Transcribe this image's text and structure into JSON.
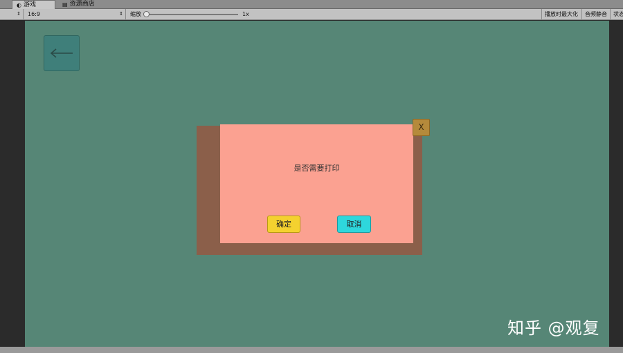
{
  "tabs": {
    "game_label": "游戏",
    "store_label": "资源商店"
  },
  "toolbar": {
    "left_dropdown_value": "",
    "aspect_value": "16:9",
    "scale_label": "缩放",
    "scale_value": "1x",
    "maximize_label": "播放时最大化",
    "mute_label": "音频静音",
    "stats_label": "状态"
  },
  "dialog": {
    "message": "是否需要打印",
    "confirm_label": "确定",
    "cancel_label": "取消",
    "close_label": "X"
  },
  "watermark": "知乎 @观复",
  "colors": {
    "viewport_bg": "#568676",
    "panel_bg": "#fba191",
    "panel_shadow": "#8b5f4a",
    "confirm_bg": "#f4d12f",
    "cancel_bg": "#2ed7dc",
    "close_bg": "#b58a3b",
    "back_bg": "#3f7f7a"
  },
  "icons": {
    "back": "arrow-left-icon",
    "game_tab": "game-controller-icon",
    "store_tab": "store-bag-icon"
  }
}
